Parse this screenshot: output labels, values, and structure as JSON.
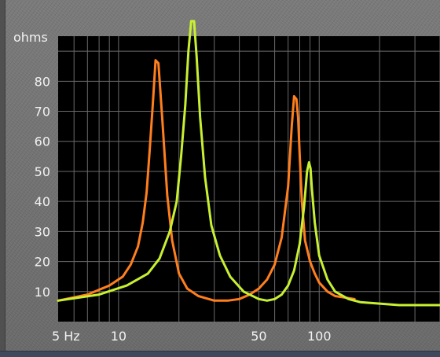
{
  "chart_data": {
    "type": "line",
    "title": "",
    "ylabel": "ohms",
    "xlabel": "",
    "x_scale": "log",
    "xlim": [
      5,
      400
    ],
    "ylim": [
      0,
      95
    ],
    "grid": true,
    "y_ticks": [
      10,
      20,
      30,
      40,
      50,
      60,
      70,
      80
    ],
    "y_tick_labels": [
      "10",
      "20",
      "30",
      "40",
      "50",
      "60",
      "70",
      "80"
    ],
    "x_tick_labels": [
      {
        "value": 5,
        "label": "5 Hz"
      },
      {
        "value": 10,
        "label": "10"
      },
      {
        "value": 50,
        "label": "50"
      },
      {
        "value": 100,
        "label": "100"
      }
    ],
    "series": [
      {
        "color": "#ff7f1e",
        "x": [
          5,
          7,
          9,
          10.5,
          11.5,
          12.5,
          13.2,
          13.8,
          14.3,
          14.8,
          15.3,
          15.8,
          16.5,
          17.5,
          18.5,
          20,
          22,
          25,
          30,
          35,
          40,
          45,
          50,
          55,
          60,
          65,
          70,
          73,
          75,
          77,
          78.5,
          80,
          82,
          85,
          90,
          95,
          100,
          110,
          120,
          150
        ],
        "y": [
          7,
          9,
          12,
          15,
          19,
          25,
          33,
          43,
          57,
          72,
          87,
          86,
          68,
          42,
          27,
          16,
          11,
          8.5,
          7,
          7,
          7.5,
          9,
          11,
          14,
          19,
          28,
          45,
          65,
          75,
          74,
          68,
          55,
          40,
          27,
          20,
          16,
          13,
          10,
          8.5,
          7.5
        ]
      },
      {
        "color": "#c8f032",
        "x": [
          5,
          8,
          11,
          14,
          16,
          18,
          19.5,
          20.5,
          21.5,
          22.3,
          23,
          23.8,
          24.5,
          25.5,
          27,
          29,
          32,
          36,
          42,
          50,
          55,
          60,
          65,
          70,
          75,
          80,
          84,
          87,
          89,
          90.5,
          92,
          95,
          100,
          110,
          120,
          140,
          160,
          200,
          250,
          300,
          400
        ],
        "y": [
          7,
          9,
          12,
          16,
          21,
          30,
          40,
          55,
          72,
          90,
          100,
          100,
          88,
          68,
          48,
          32,
          22,
          15,
          10,
          7.5,
          7,
          7.5,
          9,
          12,
          17,
          26,
          38,
          50,
          53,
          51,
          44,
          33,
          22,
          14,
          10,
          7.5,
          6.5,
          6,
          5.5,
          5.5,
          5.5
        ]
      }
    ]
  }
}
